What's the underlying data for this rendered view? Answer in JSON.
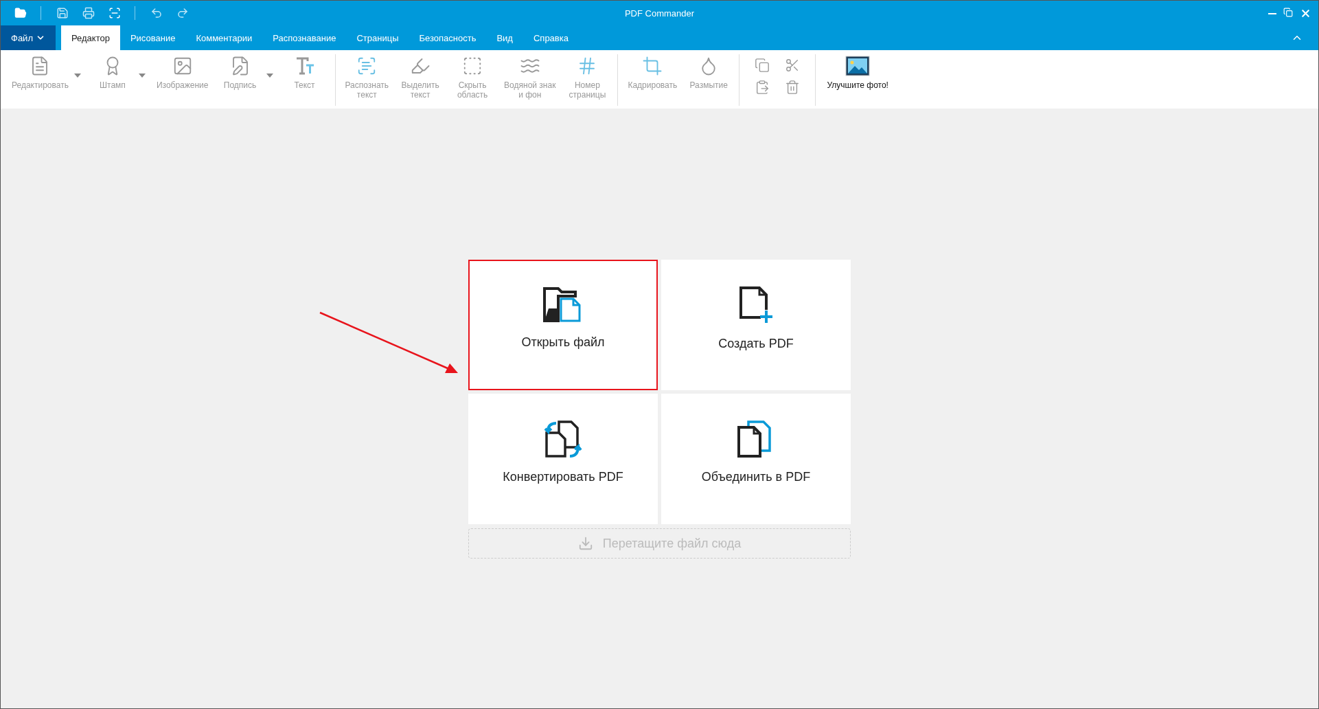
{
  "window": {
    "title": "PDF Commander"
  },
  "tabs": [
    {
      "label": "Файл",
      "kind": "menu",
      "selected": false
    },
    {
      "label": "Редактор",
      "kind": "tab",
      "selected": true
    },
    {
      "label": "Рисование",
      "kind": "tab",
      "selected": false
    },
    {
      "label": "Комментарии",
      "kind": "tab",
      "selected": false
    },
    {
      "label": "Распознавание",
      "kind": "tab",
      "selected": false
    },
    {
      "label": "Страницы",
      "kind": "tab",
      "selected": false
    },
    {
      "label": "Безопасность",
      "kind": "tab",
      "selected": false
    },
    {
      "label": "Вид",
      "kind": "tab",
      "selected": false
    },
    {
      "label": "Справка",
      "kind": "tab",
      "selected": false
    }
  ],
  "toolbar": {
    "groups": [
      {
        "items": [
          {
            "label": "Редактировать",
            "dropdown": true,
            "disabled": true
          },
          {
            "label": "Штамп",
            "dropdown": true,
            "disabled": true
          },
          {
            "label": "Изображение",
            "dropdown": false,
            "disabled": true
          },
          {
            "label": "Подпись",
            "dropdown": true,
            "disabled": true
          },
          {
            "label": "Текст",
            "dropdown": false,
            "disabled": true
          }
        ]
      },
      {
        "items": [
          {
            "label": "Распознать\nтекст",
            "dropdown": false,
            "disabled": true
          },
          {
            "label": "Выделить\nтекст",
            "dropdown": false,
            "disabled": true
          },
          {
            "label": "Скрыть\nобласть",
            "dropdown": false,
            "disabled": true
          },
          {
            "label": "Водяной знак\nи фон",
            "dropdown": false,
            "disabled": true
          },
          {
            "label": "Номер\nстраницы",
            "dropdown": false,
            "disabled": true
          }
        ]
      },
      {
        "items": [
          {
            "label": "Кадрировать",
            "dropdown": false,
            "disabled": true
          },
          {
            "label": "Размытие",
            "dropdown": false,
            "disabled": true
          }
        ]
      },
      {
        "kind": "small",
        "items": [
          {
            "disabled": true
          },
          {
            "disabled": true
          },
          {
            "disabled": true
          },
          {
            "disabled": true
          }
        ]
      },
      {
        "items": [
          {
            "label": "Улучшите фото!",
            "dropdown": false,
            "disabled": false
          }
        ]
      }
    ]
  },
  "start": {
    "cards": [
      {
        "label": "Открыть файл",
        "highlighted": true
      },
      {
        "label": "Создать PDF",
        "highlighted": false
      },
      {
        "label": "Конвертировать PDF",
        "highlighted": false
      },
      {
        "label": "Объединить в PDF",
        "highlighted": false
      }
    ],
    "drop_zone": {
      "label": "Перетащите файл сюда"
    }
  }
}
